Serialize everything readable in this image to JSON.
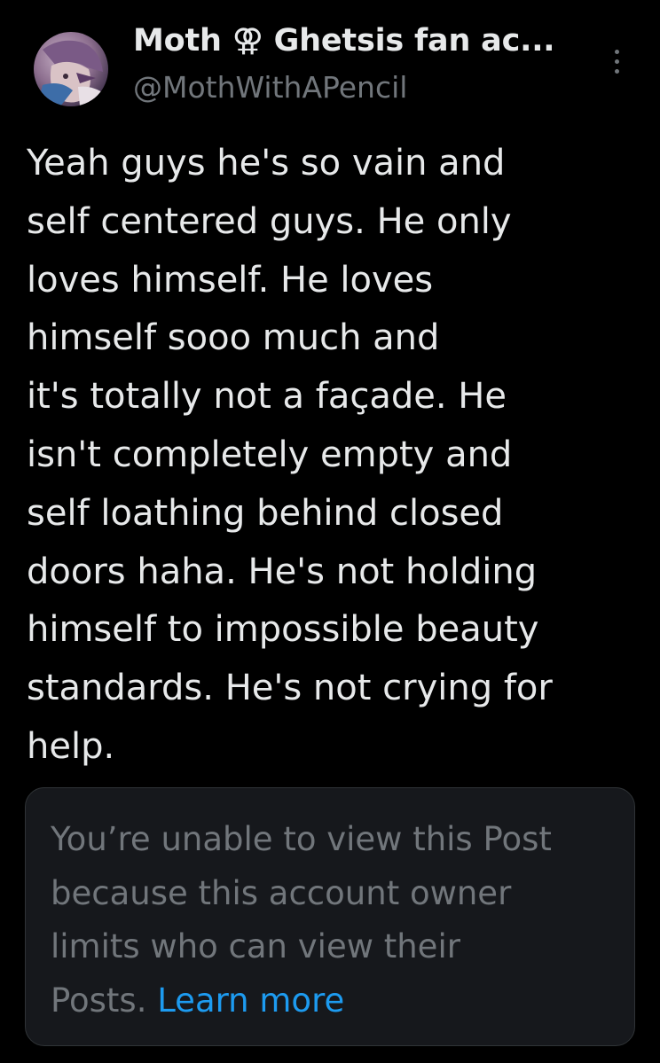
{
  "author": {
    "display_name": "Moth ⚢ Ghetsis fan ac...",
    "handle": "@MothWithAPencil"
  },
  "tweet": {
    "lines": [
      "Yeah guys he's so vain and",
      "self centered guys. He only",
      "loves himself. He loves",
      "himself sooo much and",
      "it's totally not a façade. He",
      "isn't completely empty and",
      "self loathing behind closed",
      "doors haha. He's not holding",
      "himself to impossible beauty",
      "standards. He's not crying for",
      "help."
    ]
  },
  "notice": {
    "lines": [
      "You’re unable to view this Post",
      "because this account owner",
      "limits who can view their"
    ],
    "last_line_prefix": "Posts. ",
    "learn_more_label": "Learn more"
  },
  "colors": {
    "background": "#000000",
    "primary_text": "#e7e9ea",
    "secondary_text": "#71767b",
    "link": "#1d9bf0",
    "card_background": "#16181c"
  },
  "icons": {
    "more": "more-vertical-icon"
  }
}
